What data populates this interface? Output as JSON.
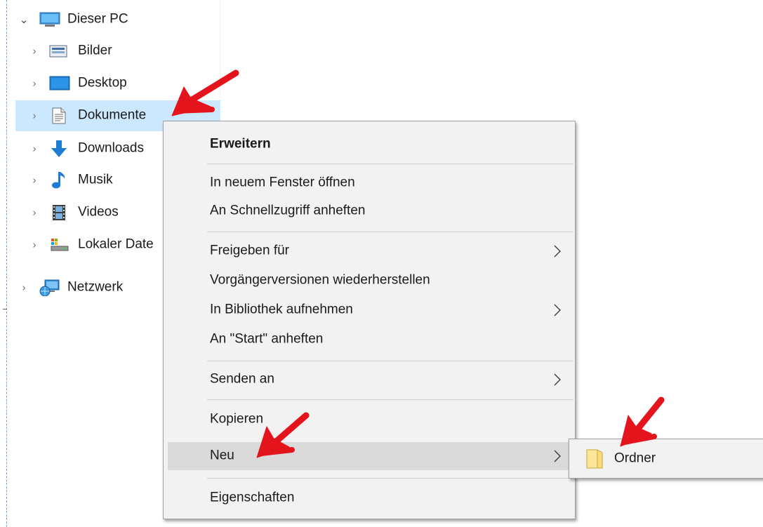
{
  "nav_tree": {
    "items": [
      {
        "label": "Dieser PC",
        "expanded": true,
        "icon": "computer-icon"
      },
      {
        "label": "Bilder",
        "icon": "pictures-icon"
      },
      {
        "label": "Desktop",
        "icon": "desktop-icon"
      },
      {
        "label": "Dokumente",
        "icon": "documents-icon",
        "selected": true
      },
      {
        "label": "Downloads",
        "icon": "download-arrow-icon"
      },
      {
        "label": "Musik",
        "icon": "music-note-icon"
      },
      {
        "label": "Videos",
        "icon": "film-icon"
      },
      {
        "label": "Lokaler Date",
        "icon": "local-drive-icon"
      },
      {
        "label": "Netzwerk",
        "icon": "network-icon"
      }
    ]
  },
  "context_menu": {
    "items": [
      {
        "label": "Erweitern",
        "bold": true
      },
      {
        "label": "In neuem Fenster öffnen"
      },
      {
        "label": "An Schnellzugriff anheften"
      },
      {
        "label": "Freigeben für",
        "submenu": true
      },
      {
        "label": "Vorgängerversionen wiederherstellen"
      },
      {
        "label": "In Bibliothek aufnehmen",
        "submenu": true
      },
      {
        "label": "An \"Start\" anheften"
      },
      {
        "label": "Senden an",
        "submenu": true
      },
      {
        "label": "Kopieren"
      },
      {
        "label": "Neu",
        "submenu": true,
        "highlighted": true
      },
      {
        "label": "Eigenschaften"
      }
    ]
  },
  "submenu_new": {
    "items": [
      {
        "label": "Ordner",
        "icon": "folder-icon"
      }
    ]
  },
  "colors": {
    "selection": "#cce8ff",
    "menu_background": "#f2f2f2",
    "menu_hover": "#dadada",
    "annotation_arrow": "#e3141b",
    "download_blue": "#1e7bd6",
    "folder_yellow": "#f8dc7a"
  }
}
